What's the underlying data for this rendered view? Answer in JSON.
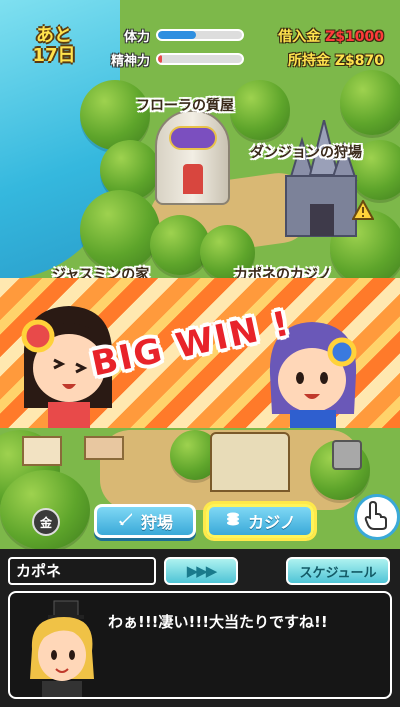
{
  "hud": {
    "days_prefix": "あと",
    "days_value": "17日",
    "stamina_label": "体力",
    "stamina_level": 0.45,
    "mental_label": "精神力",
    "mental_level": 0.05,
    "debt_label": "借入金",
    "debt_value": "Z$1000",
    "money_label": "所持金",
    "money_value": "Z$870"
  },
  "map_labels": {
    "flora": "フローラの質屋",
    "dungeon": "ダンジョンの狩場",
    "jasmine": "ジャスミンの家",
    "casino": "カポネのカジノ"
  },
  "event": {
    "banner": "BIG WIN !"
  },
  "nav": {
    "gold_label": "金",
    "hunt_label": "狩場",
    "casino_label": "カジノ"
  },
  "dialog": {
    "speaker": "カポネ",
    "ffw_label": "▶▶▶",
    "schedule_label": "スケジュール",
    "message": "わぁ!!!凄い!!!大当たりですね!!"
  },
  "colors": {
    "stamina_fill": "#2f8fe0",
    "mental_fill": "#e84a4a",
    "debt_color": "#ff3b3b",
    "money_color": "#ffe34d"
  }
}
